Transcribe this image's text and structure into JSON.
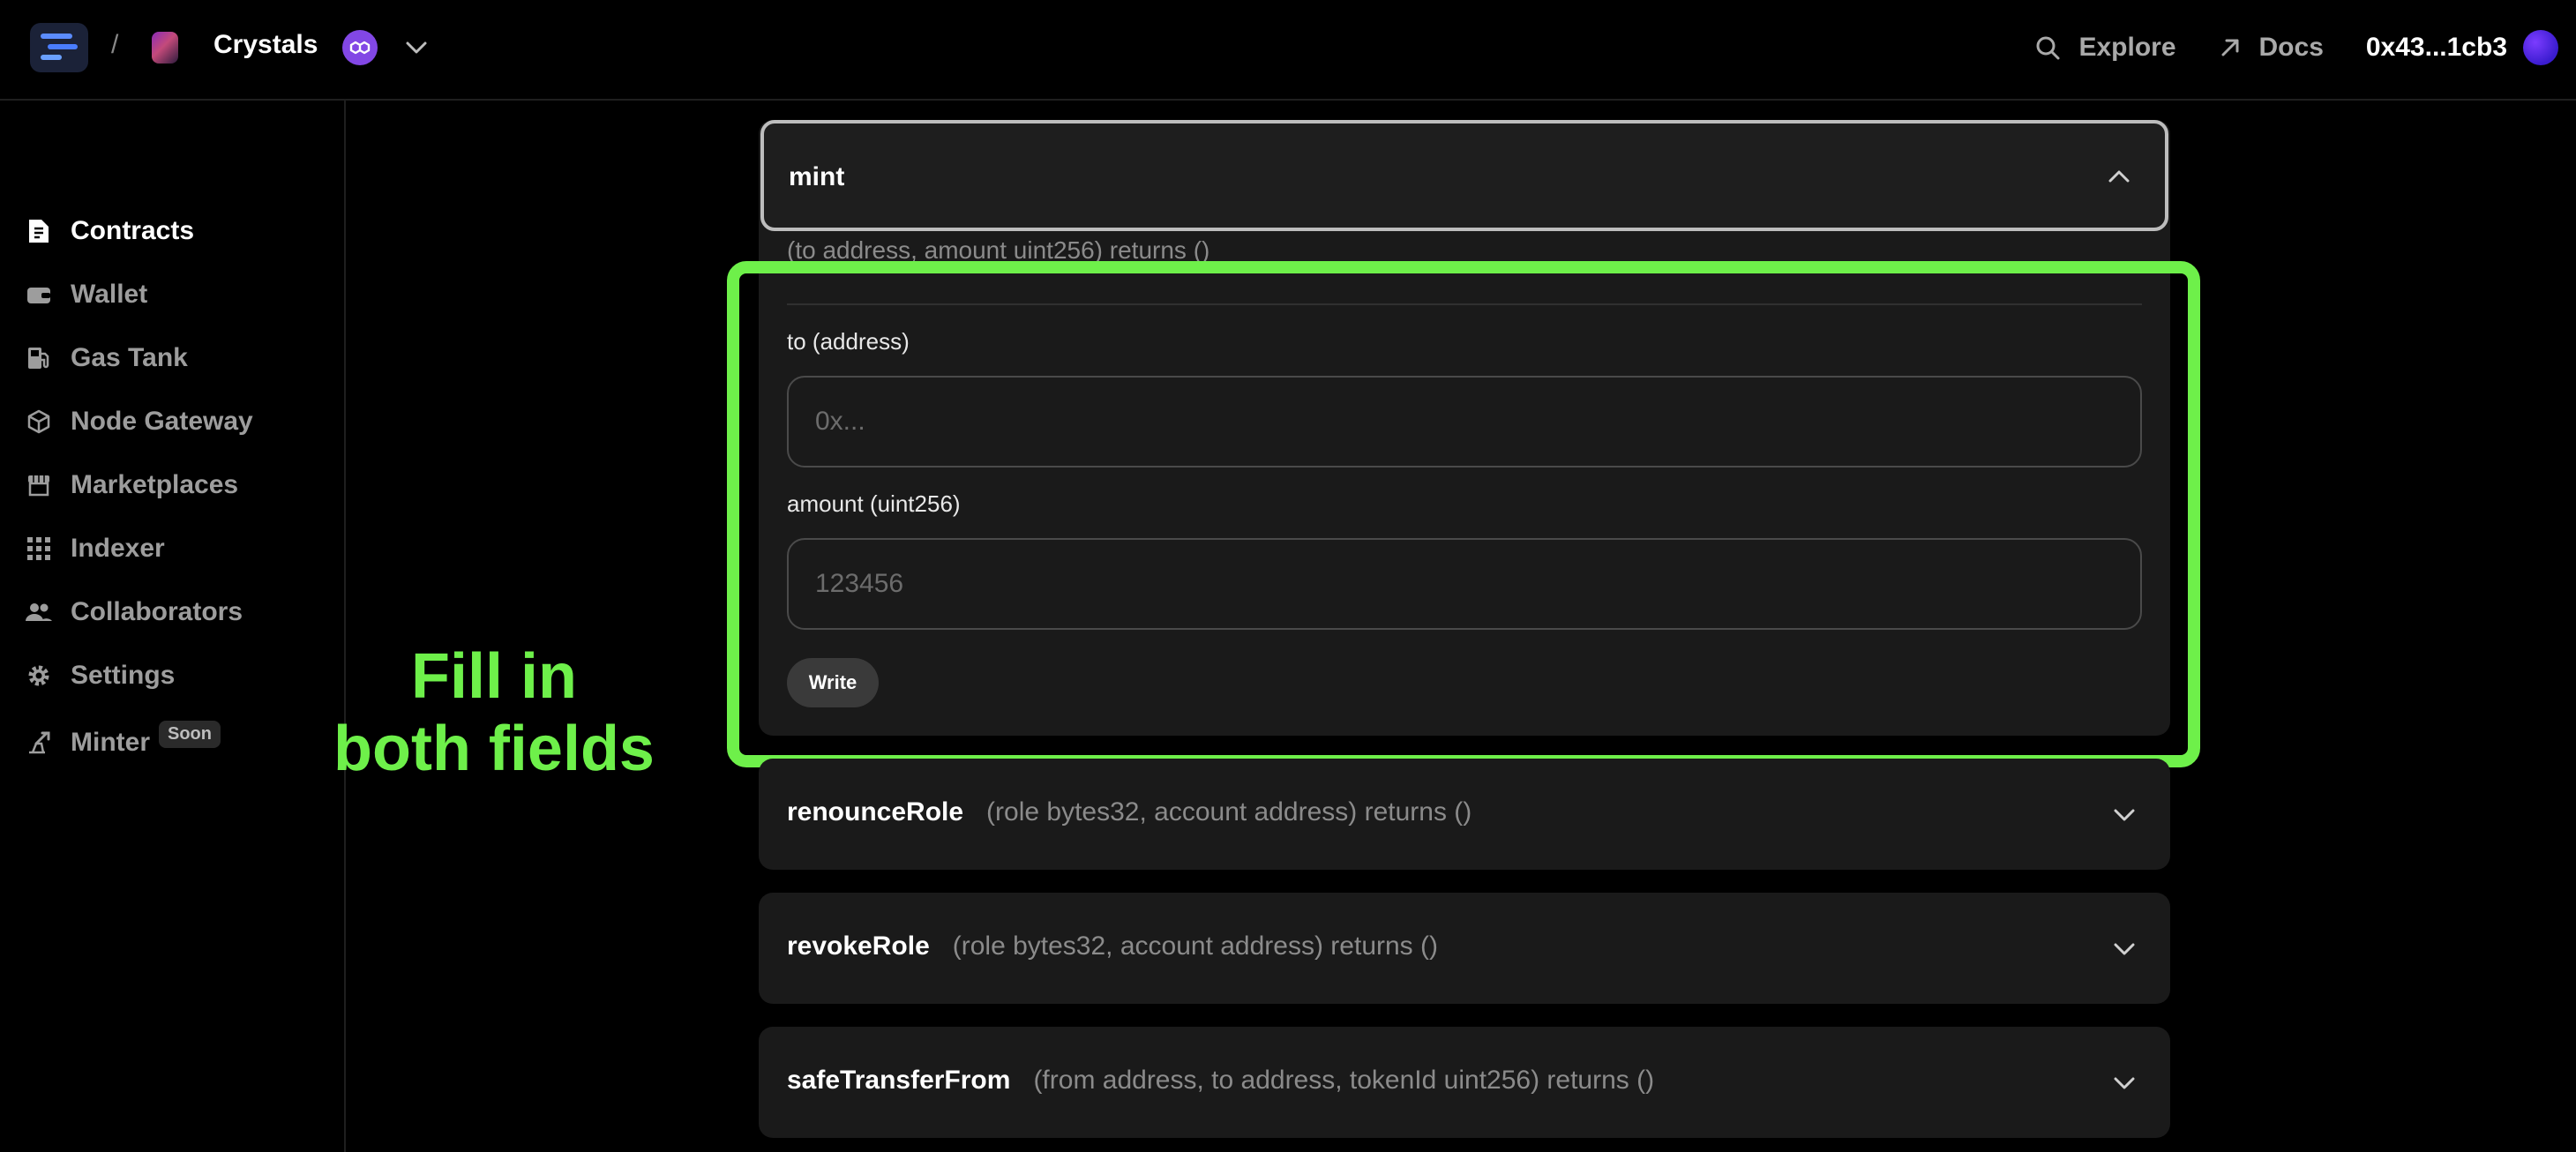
{
  "header": {
    "separator": "/",
    "project_name": "Crystals",
    "chain_icon": "polygon-icon",
    "nav": [
      {
        "label": "Explore",
        "icon": "search-icon"
      },
      {
        "label": "Docs",
        "icon": "arrow-up-right-icon"
      }
    ],
    "wallet_address": "0x43...1cb3"
  },
  "sidebar": {
    "items": [
      {
        "label": "Contracts",
        "icon": "contract-icon",
        "active": true
      },
      {
        "label": "Wallet",
        "icon": "wallet-icon"
      },
      {
        "label": "Gas Tank",
        "icon": "gas-pump-icon"
      },
      {
        "label": "Node Gateway",
        "icon": "cube-icon"
      },
      {
        "label": "Marketplaces",
        "icon": "storefront-icon"
      },
      {
        "label": "Indexer",
        "icon": "grid-icon"
      },
      {
        "label": "Collaborators",
        "icon": "users-icon"
      },
      {
        "label": "Settings",
        "icon": "gear-icon"
      },
      {
        "label": "Minter",
        "icon": "minter-icon",
        "badge": "Soon"
      }
    ]
  },
  "annotation": {
    "line1": "Fill in",
    "line2": "both fields",
    "color": "#6ef04a"
  },
  "functions": {
    "mint": {
      "name": "mint",
      "signature": "(to address, amount uint256) returns ()",
      "fields": [
        {
          "label": "to (address)",
          "placeholder": "0x...",
          "value": ""
        },
        {
          "label": "amount (uint256)",
          "placeholder": "123456",
          "value": ""
        }
      ],
      "write_label": "Write"
    },
    "collapsed": [
      {
        "name": "renounceRole",
        "signature": "(role bytes32, account address) returns ()"
      },
      {
        "name": "revokeRole",
        "signature": "(role bytes32, account address) returns ()"
      },
      {
        "name": "safeTransferFrom",
        "signature": "(from address, to address, tokenId uint256) returns ()"
      }
    ]
  }
}
